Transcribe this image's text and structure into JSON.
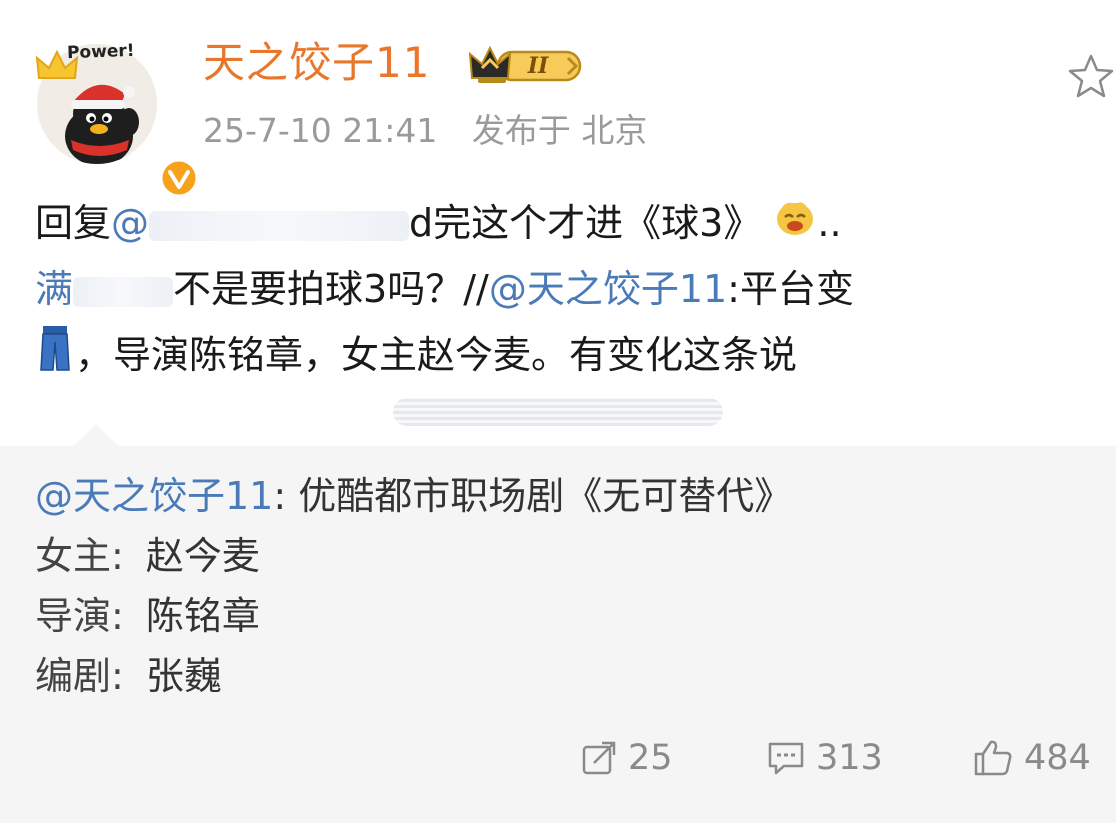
{
  "header": {
    "avatar_caption": "Power!",
    "username": "天之饺子11",
    "vip_level": "II",
    "timestamp": "25-7-10 21:41",
    "published_at": "发布于 北京"
  },
  "post": {
    "line1_prefix": "回复",
    "line1_mention": "@",
    "line1_tail": "d完这个才进《球3》",
    "line1_end": "..",
    "line2_start": "满",
    "line2_mid": "不是要拍球3吗？//",
    "line2_mention": "@天之饺子11",
    "line2_tail": ":平台变",
    "line3_text": "，导演陈铭章，女主赵今麦。有变化这条说"
  },
  "repost": {
    "author": "@天之饺子11",
    "headline": ": 优酷都市职场剧《无可替代》",
    "rows": [
      {
        "key": "女主:",
        "value": "赵今麦"
      },
      {
        "key": "导演:",
        "value": "陈铭章"
      },
      {
        "key": "编剧:",
        "value": "张巍"
      }
    ]
  },
  "actions": {
    "repost_count": "25",
    "comment_count": "313",
    "like_count": "484"
  },
  "colors": {
    "username": "#e8772c",
    "mention": "#4a7bb8",
    "meta": "#9a9a9a",
    "repost_bg": "#f5f5f5"
  }
}
